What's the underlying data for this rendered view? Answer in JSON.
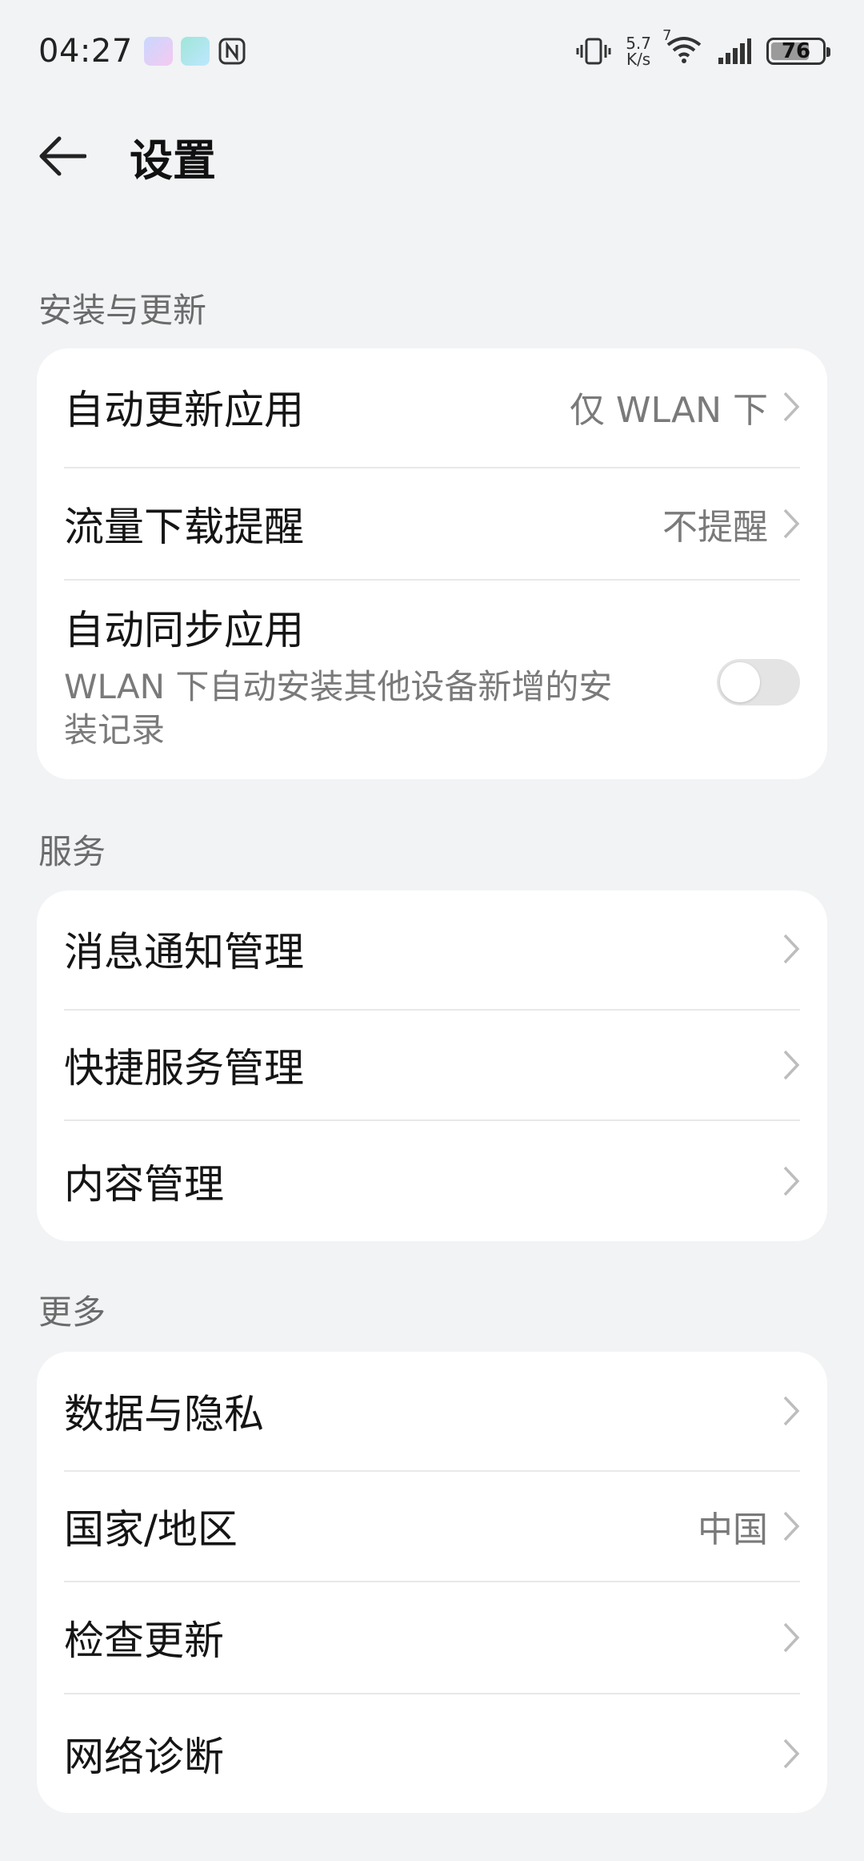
{
  "status": {
    "time": "04:27",
    "speed_value": "5.7",
    "speed_unit": "K/s",
    "wifi_badge": "7",
    "battery": "76",
    "battery_level": 0.76
  },
  "header": {
    "title": "设置"
  },
  "sections": {
    "install": {
      "title": "安装与更新",
      "auto_update": {
        "label": "自动更新应用",
        "value": "仅 WLAN 下"
      },
      "traffic_reminder": {
        "label": "流量下载提醒",
        "value": "不提醒"
      },
      "auto_sync": {
        "label": "自动同步应用",
        "desc_line1": "WLAN 下自动安装其他设备新增的安",
        "desc_line2": "装记录",
        "enabled": false
      }
    },
    "service": {
      "title": "服务",
      "items": [
        {
          "label": "消息通知管理"
        },
        {
          "label": "快捷服务管理"
        },
        {
          "label": "内容管理"
        }
      ]
    },
    "more": {
      "title": "更多",
      "items": [
        {
          "label": "数据与隐私",
          "value": ""
        },
        {
          "label": "国家/地区",
          "value": "中国"
        },
        {
          "label": "检查更新",
          "value": ""
        },
        {
          "label": "网络诊断",
          "value": ""
        }
      ]
    }
  },
  "colors": {
    "background": "#f1f3f5",
    "card": "#ffffff",
    "secondary_text": "#7a7a7a"
  }
}
